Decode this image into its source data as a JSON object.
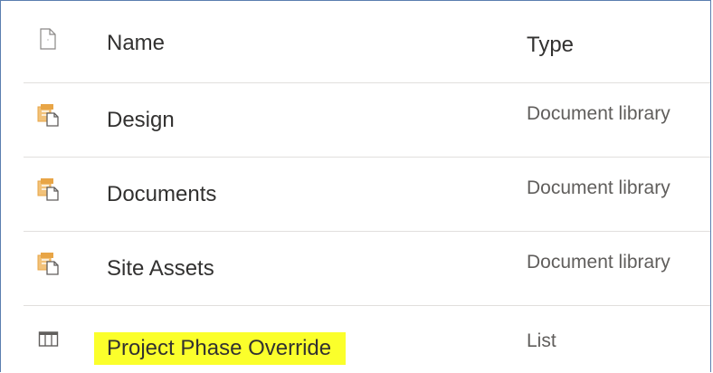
{
  "header": {
    "name_label": "Name",
    "type_label": "Type",
    "icon": "file-type-icon"
  },
  "rows": [
    {
      "name": "Design",
      "type": "Document library",
      "icon": "document-library-icon"
    },
    {
      "name": "Documents",
      "type": "Document library",
      "icon": "document-library-icon"
    },
    {
      "name": "Site Assets",
      "type": "Document library",
      "icon": "document-library-icon"
    },
    {
      "name": "Project Phase Override",
      "type": "List",
      "icon": "list-icon",
      "highlighted": true
    }
  ],
  "colors": {
    "highlight": "#fbff2b",
    "library_icon": "#e8a546",
    "border": "#5b7fb0"
  }
}
